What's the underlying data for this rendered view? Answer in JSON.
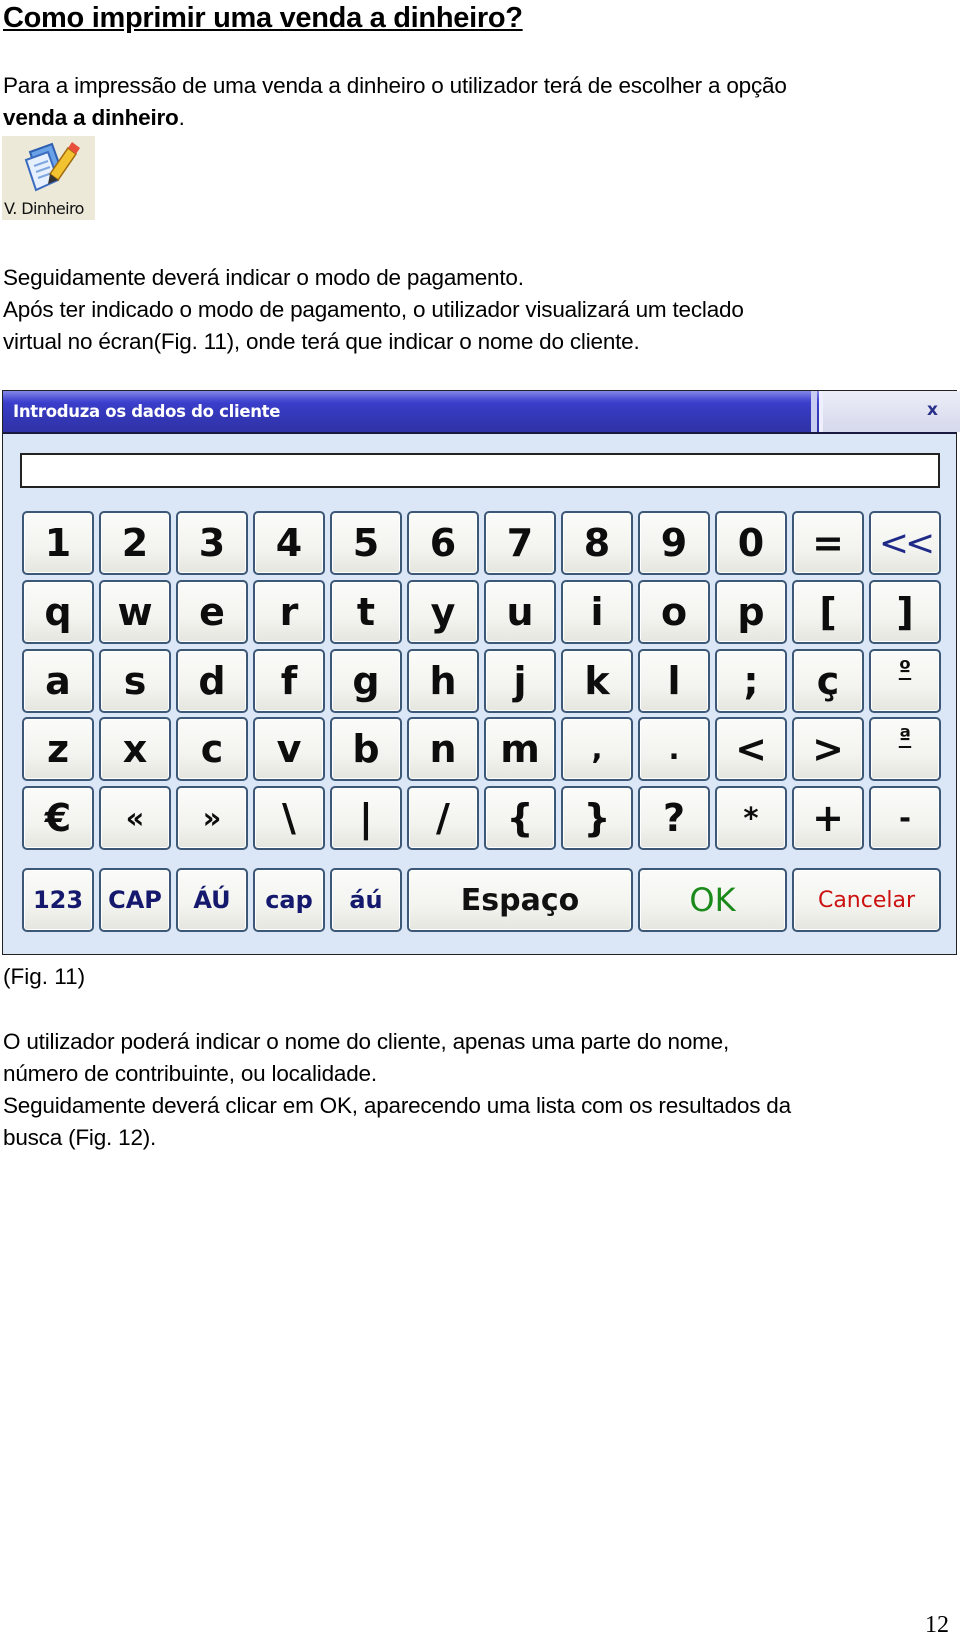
{
  "page": {
    "heading": "Como imprimir uma venda a dinheiro?",
    "intro_line1": "Para a impressão de uma venda a dinheiro o utilizador terá de escolher a opção",
    "intro_bold": "venda a dinheiro",
    "intro_end": ".",
    "option_icon": {
      "icon": "document-pencil-icon",
      "label": "V. Dinheiro"
    },
    "para2_lines": [
      "Seguidamente deverá indicar o modo de pagamento.",
      "Após ter indicado o modo de pagamento, o utilizador visualizará um teclado",
      "virtual no écran(Fig. 11), onde terá que indicar o nome do cliente."
    ],
    "figure_caption": "(Fig. 11)",
    "para3_lines": [
      "O utilizador poderá indicar o nome do cliente, apenas uma parte do nome,",
      "número de contribuinte, ou localidade.",
      "Seguidamente deverá clicar em OK, aparecendo uma lista com os resultados da",
      "busca (Fig. 12)."
    ],
    "page_number": "12"
  },
  "dialog": {
    "title": "Introduza os dados do cliente",
    "close_label": "x",
    "input_value": "",
    "keyboard_rows": [
      [
        "1",
        "2",
        "3",
        "4",
        "5",
        "6",
        "7",
        "8",
        "9",
        "0",
        "=",
        "<<"
      ],
      [
        "q",
        "w",
        "e",
        "r",
        "t",
        "y",
        "u",
        "i",
        "o",
        "p",
        "[",
        "]"
      ],
      [
        "a",
        "s",
        "d",
        "f",
        "g",
        "h",
        "j",
        "k",
        "l",
        ";",
        "ç",
        "º"
      ],
      [
        "z",
        "x",
        "c",
        "v",
        "b",
        "n",
        "m",
        ",",
        ".",
        "<",
        ">",
        "ª"
      ],
      [
        "€",
        "«",
        "»",
        "\\",
        "|",
        "/",
        "{",
        "}",
        "?",
        "*",
        "+",
        "-"
      ]
    ],
    "bottom_row": {
      "num_mode": "123",
      "caps_upper": "CAP",
      "accent_upper": "ÁÚ",
      "caps_lower": "cap",
      "accent_lower": "áú",
      "space": "Espaço",
      "ok": "OK",
      "cancel": "Cancelar"
    },
    "colors": {
      "titlebar": "#3438b8",
      "ok_text": "#1a8a1a",
      "cancel_text": "#cc1111",
      "fn_text": "#14196e"
    }
  }
}
